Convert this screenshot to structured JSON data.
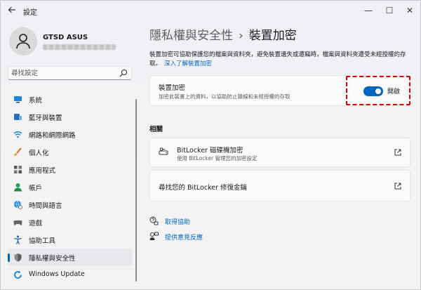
{
  "window": {
    "title": "設定",
    "controls": {
      "minimize": "—",
      "maximize": "☐",
      "close": "✕"
    },
    "back_icon": "arrow-left-icon"
  },
  "profile": {
    "name": "GTSD ASUS",
    "email_redacted": true
  },
  "search": {
    "placeholder": "尋找設定",
    "icon": "search-icon"
  },
  "sidebar": {
    "items": [
      {
        "label": "系統",
        "icon": "system-icon",
        "color": "#0067c0",
        "active": false
      },
      {
        "label": "藍牙與裝置",
        "icon": "bluetooth-devices-icon",
        "color": "#0067c0",
        "active": false
      },
      {
        "label": "網路和網際網路",
        "icon": "wifi-icon",
        "color": "#0067c0",
        "active": false
      },
      {
        "label": "個人化",
        "icon": "brush-icon",
        "color": "#d66a1e",
        "active": false
      },
      {
        "label": "應用程式",
        "icon": "apps-icon",
        "color": "#555555",
        "active": false
      },
      {
        "label": "帳戶",
        "icon": "account-icon",
        "color": "#2aa05a",
        "active": false
      },
      {
        "label": "時間與語言",
        "icon": "globe-clock-icon",
        "color": "#0067c0",
        "active": false
      },
      {
        "label": "遊戲",
        "icon": "game-controller-icon",
        "color": "#555555",
        "active": false
      },
      {
        "label": "協助工具",
        "icon": "accessibility-icon",
        "color": "#0067c0",
        "active": false
      },
      {
        "label": "隱私權與安全性",
        "icon": "shield-icon",
        "color": "#555555",
        "active": true
      },
      {
        "label": "Windows Update",
        "icon": "windows-update-icon",
        "color": "#0067c0",
        "active": false
      }
    ]
  },
  "main": {
    "breadcrumb": {
      "parent": "隱私權與安全性",
      "separator": "›",
      "current": "裝置加密"
    },
    "description": "裝置加密可協助保護您的檔案與資料夾，避免裝置遺失或遭竊時，檔案與資料夾遭受未經授權的存取。",
    "description_link": "深入了解裝置加密",
    "encryption_card": {
      "title": "裝置加密",
      "subtitle": "加密此裝置上的資料，以協助防止錄線和未經授權的存取",
      "toggle_on": true,
      "toggle_label": "開啟"
    },
    "related_title": "相關",
    "related_cards": {
      "bitlocker_title": "BitLocker 磁碟機加密",
      "bitlocker_subtitle": "使用 BitLocker 管理您的加密設定",
      "recovery_title": "尋找您的 BitLocker 修復金鑰"
    },
    "links": {
      "help": "取得協助",
      "feedback": "提供意見反應"
    }
  },
  "colors": {
    "accent": "#0067c0",
    "highlight": "#e00000"
  }
}
